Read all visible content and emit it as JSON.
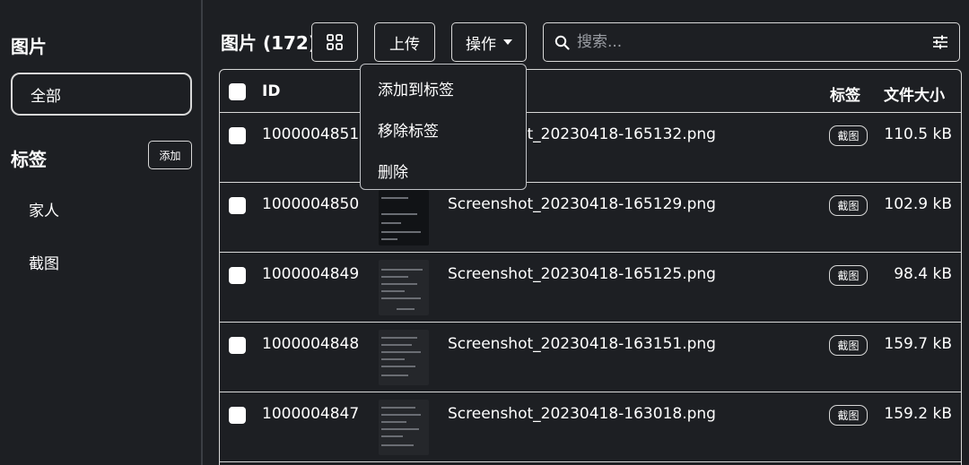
{
  "sidebar": {
    "title": "图片",
    "all_label": "全部",
    "tags_title": "标签",
    "add_label": "添加",
    "tags": [
      "家人",
      "截图"
    ]
  },
  "toolbar": {
    "page_title": "图片 (172)",
    "grid_icon": "grid-icon",
    "upload_label": "上传",
    "ops_label": "操作",
    "search_placeholder": "搜索...",
    "search_icon": "search-icon",
    "filter_icon": "sliders-icon"
  },
  "dropdown": {
    "items": [
      "添加到标签",
      "移除标签",
      "删除"
    ]
  },
  "table": {
    "headers": {
      "id": "ID",
      "tags": "标签",
      "size": "文件大小"
    },
    "rows": [
      {
        "id": "1000004851",
        "name": "Screenshot_20230418-165132.png",
        "tag": "截图",
        "size": "110.5 kB"
      },
      {
        "id": "1000004850",
        "name": "Screenshot_20230418-165129.png",
        "tag": "截图",
        "size": "102.9 kB"
      },
      {
        "id": "1000004849",
        "name": "Screenshot_20230418-165125.png",
        "tag": "截图",
        "size": "98.4 kB"
      },
      {
        "id": "1000004848",
        "name": "Screenshot_20230418-163151.png",
        "tag": "截图",
        "size": "159.7 kB"
      },
      {
        "id": "1000004847",
        "name": "Screenshot_20230418-163018.png",
        "tag": "截图",
        "size": "159.2 kB"
      }
    ]
  },
  "colors": {
    "background": "#1d1f23",
    "border": "#d8d8d8",
    "text": "#ffffff"
  }
}
